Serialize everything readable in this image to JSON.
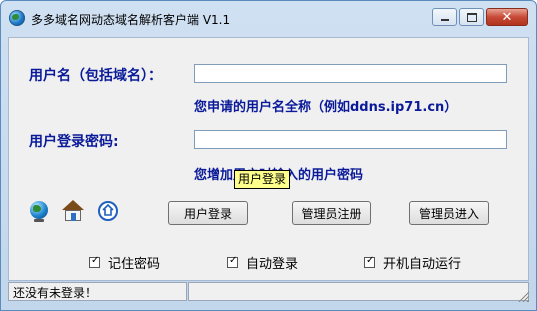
{
  "window": {
    "title": "多多域名网动态域名解析客户端 V1.1",
    "controls": {
      "minimize": "minimize-icon",
      "maximize": "maximize-icon",
      "close": "close-icon"
    }
  },
  "form": {
    "username_label": "用户名（包括域名）：",
    "username_value": "",
    "username_hint": "您申请的用户名全称（例如ddns.ip71.cn）",
    "password_label": "用户登录密码:",
    "password_value": "",
    "password_hint": "您增加用户时输入的用户密码"
  },
  "icons": [
    "globe-icon",
    "house-icon",
    "home-circle-icon"
  ],
  "buttons": {
    "login": "用户登录",
    "admin_register": "管理员注册",
    "admin_login": "管理员进入"
  },
  "tooltip": "用户登录",
  "options": [
    {
      "label": "记住密码",
      "checked": true
    },
    {
      "label": "自动登录",
      "checked": true
    },
    {
      "label": "开机自动运行",
      "checked": true
    }
  ],
  "status": {
    "message": "还没有未登录！",
    "pane2": ""
  },
  "colors": {
    "label_blue": "#0a1a99",
    "tooltip_bg": "#ffff8c",
    "close_red": "#c74a36"
  }
}
